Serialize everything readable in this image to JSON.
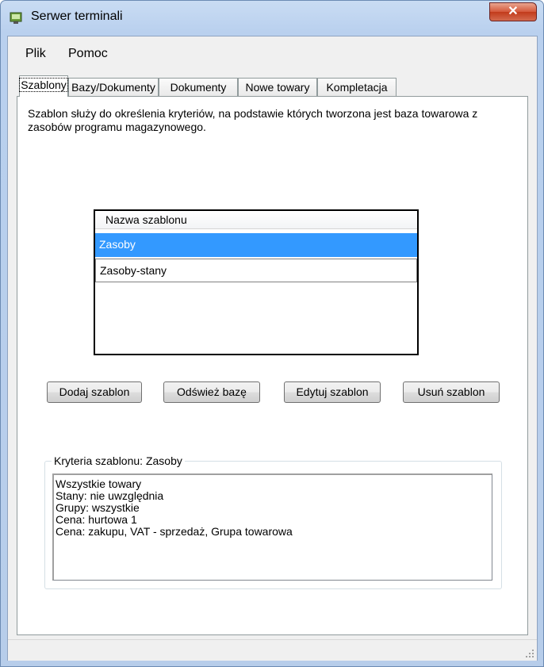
{
  "window": {
    "title": "Serwer terminali",
    "close_symbol": "✕"
  },
  "menu": [
    {
      "label": "Plik"
    },
    {
      "label": "Pomoc"
    }
  ],
  "tabs": [
    {
      "label": "Szablony",
      "active": true
    },
    {
      "label": "Bazy/Dokumenty"
    },
    {
      "label": "Dokumenty"
    },
    {
      "label": "Nowe towary"
    },
    {
      "label": "Kompletacja"
    }
  ],
  "description": "Szablon służy do określenia kryteriów, na podstawie których tworzona jest baza towarowa z zasobów programu magazynowego.",
  "template_list": {
    "column_header": "Nazwa szablonu",
    "rows": [
      "Zasoby",
      "Zasoby-stany"
    ],
    "selected": "Zasoby"
  },
  "buttons": {
    "add": "Dodaj szablon",
    "refresh": "Odśwież bazę",
    "edit": "Edytuj szablon",
    "delete": "Usuń szablon"
  },
  "criteria": {
    "legend": "Kryteria szablonu: Zasoby",
    "lines": [
      "Wszystkie towary",
      "Stany: nie uwzględnia",
      "Grupy: wszystkie",
      "Cena: hurtowa 1",
      "Cena: zakupu, VAT - sprzedaż, Grupa towarowa"
    ]
  },
  "colors": {
    "selection": "#3399ff",
    "window_frame": "#b9d0ee"
  }
}
